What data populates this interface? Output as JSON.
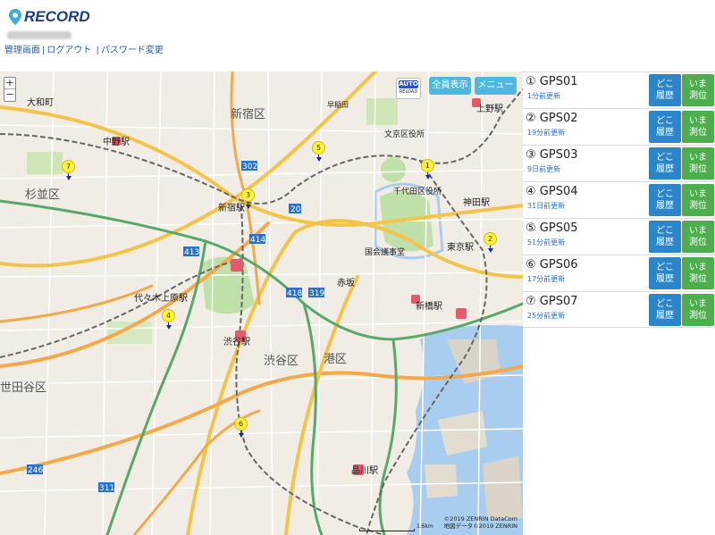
{
  "header": {
    "logo_text": "RECORD",
    "links": [
      "管理画面",
      "ログアウト",
      "パスワード変更"
    ]
  },
  "map": {
    "buttons": {
      "show_all": "全員表示",
      "menu": "メニュー",
      "auto": "AUTO",
      "reload": "RELOAD"
    },
    "zoom": {
      "in": "+",
      "out": "−"
    },
    "scale": "1.6km",
    "copyright": [
      "©2019 ZENRIN DataCom",
      "地図データ©2019 ZENRIN"
    ],
    "labels": [
      {
        "id": "ueno",
        "text": "上野駅"
      },
      {
        "id": "nakano",
        "text": "中野駅"
      },
      {
        "id": "shinjuku-ku",
        "text": "新宿区"
      },
      {
        "id": "shinjuku",
        "text": "新宿駅"
      },
      {
        "id": "tokyo",
        "text": "東京駅"
      },
      {
        "id": "kanda",
        "text": "神田駅"
      },
      {
        "id": "suginami",
        "text": "杉並区"
      },
      {
        "id": "shibuya",
        "text": "渋谷駅"
      },
      {
        "id": "shibuya-ku",
        "text": "渋谷区"
      },
      {
        "id": "minato",
        "text": "港区"
      },
      {
        "id": "shimbashi",
        "text": "新橋駅"
      },
      {
        "id": "shinagawa",
        "text": "品川駅"
      },
      {
        "id": "yoyogi",
        "text": "代々木上原駅"
      },
      {
        "id": "setagaya",
        "text": "世田谷区"
      },
      {
        "id": "kokkai",
        "text": "国会議事堂"
      },
      {
        "id": "akasaka",
        "text": "赤坂"
      },
      {
        "id": "bunkyo",
        "text": "文京区役所"
      },
      {
        "id": "chiyoda",
        "text": "千代田区役所"
      },
      {
        "id": "daiwa",
        "text": "大和町"
      },
      {
        "id": "ikebukuro",
        "text": "早稲田"
      }
    ]
  },
  "devices": [
    {
      "marker": "①",
      "name": "GPS01",
      "updated": "1分前更新",
      "history_label": [
        "どこ",
        "履歴"
      ],
      "now_label": [
        "いま",
        "測位"
      ]
    },
    {
      "marker": "②",
      "name": "GPS02",
      "updated": "19分前更新",
      "history_label": [
        "どこ",
        "履歴"
      ],
      "now_label": [
        "いま",
        "測位"
      ]
    },
    {
      "marker": "③",
      "name": "GPS03",
      "updated": "9日前更新",
      "history_label": [
        "どこ",
        "履歴"
      ],
      "now_label": [
        "いま",
        "測位"
      ]
    },
    {
      "marker": "④",
      "name": "GPS04",
      "updated": "31日前更新",
      "history_label": [
        "どこ",
        "履歴"
      ],
      "now_label": [
        "いま",
        "測位"
      ]
    },
    {
      "marker": "⑤",
      "name": "GPS05",
      "updated": "51分前更新",
      "history_label": [
        "どこ",
        "履歴"
      ],
      "now_label": [
        "いま",
        "測位"
      ]
    },
    {
      "marker": "⑥",
      "name": "GPS06",
      "updated": "17分前更新",
      "history_label": [
        "どこ",
        "履歴"
      ],
      "now_label": [
        "いま",
        "測位"
      ]
    },
    {
      "marker": "⑦",
      "name": "GPS07",
      "updated": "25分前更新",
      "history_label": [
        "どこ",
        "履歴"
      ],
      "now_label": [
        "いま",
        "測位"
      ]
    }
  ],
  "markers": [
    "1",
    "2",
    "3",
    "4",
    "5",
    "6",
    "7"
  ],
  "colors": {
    "link": "#2a5db0",
    "history_button": "#2a85c9",
    "now_button": "#4cae4c",
    "map_button": "#4fb8e0",
    "marker": "#fff23a"
  }
}
